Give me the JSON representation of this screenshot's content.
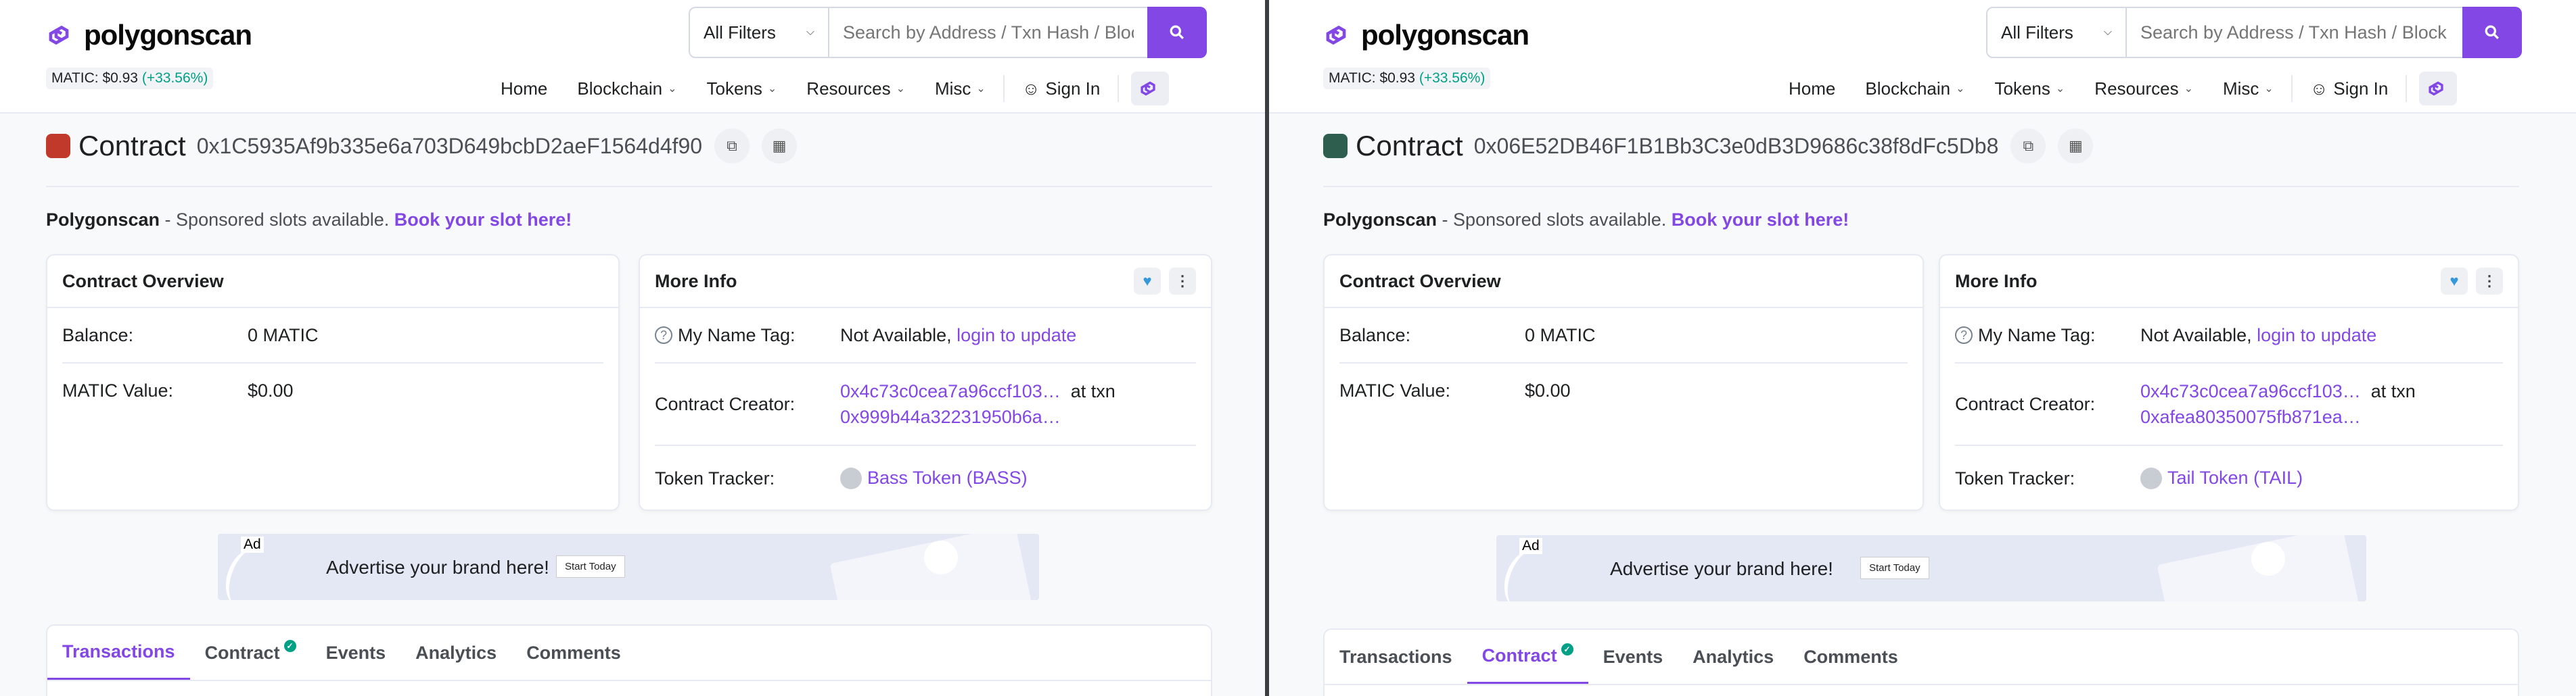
{
  "brand": {
    "name": "polygonscan",
    "accent": "#8247e5",
    "positive": "#00a186"
  },
  "header": {
    "price_label": "MATIC: $0.93",
    "price_change": "(+33.56%)",
    "filter": "All Filters",
    "search_placeholder": "Search by Address / Txn Hash / Block / Token",
    "nav": [
      "Home",
      "Blockchain",
      "Tokens",
      "Resources",
      "Misc"
    ],
    "sign_in": "Sign In"
  },
  "sponsor": {
    "name": "Polygonscan",
    "text": " - Sponsored slots available. ",
    "link": "Book your slot here!"
  },
  "overview": {
    "title": "Contract Overview",
    "balance_label": "Balance:",
    "balance": "0 MATIC",
    "value_label": "MATIC Value:",
    "value": "$0.00"
  },
  "more_info": {
    "title": "More Info",
    "name_tag_label": "My Name Tag:",
    "name_tag_value": "Not Available, ",
    "name_tag_link": "login to update",
    "creator_label": "Contract Creator:",
    "at_txn": "at txn",
    "tracker_label": "Token Tracker:"
  },
  "ad": {
    "tag": "Ad",
    "text": "Advertise your brand here!",
    "button": "Start Today"
  },
  "tabs": [
    "Transactions",
    "Contract",
    "Events",
    "Analytics",
    "Comments"
  ],
  "left": {
    "contract_label": "Contract",
    "address": "0x1C5935Af9b335e6a703D649bcbD2aeF1564d4f90",
    "avatar_color": "#c0392b",
    "creator": "0x4c73c0cea7a96ccf103…",
    "creator_txn": "0x999b44a32231950b6a…",
    "token": "Bass Token (BASS)",
    "active_tab": "Transactions"
  },
  "right": {
    "contract_label": "Contract",
    "address": "0x06E52DB46F1B1Bb3C3e0dB3D9686c38f8dFc5Db8",
    "avatar_color": "#2e5e4e",
    "creator": "0x4c73c0cea7a96ccf103…",
    "creator_txn": "0xafea80350075fb871ea…",
    "token": "Tail Token (TAIL)",
    "active_tab": "Contract"
  }
}
